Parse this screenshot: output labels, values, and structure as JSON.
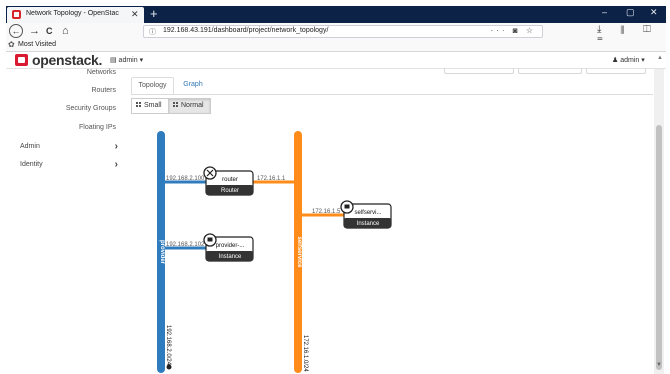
{
  "browser": {
    "tab_title": "Network Topology - OpenStac",
    "tab_close": "✕",
    "new_tab": "+",
    "window_controls": [
      "–",
      "▢",
      "✕"
    ],
    "back": "←",
    "forward": "→",
    "reload": "C",
    "home": "⌂",
    "url": "192.168.43.191/dashboard/project/network_topology/",
    "url_info_icon": "ⓘ",
    "url_actions": "··· ◙ ☆",
    "toolbar_icons": "⤓ ⫴ ◫ ≡",
    "bookmark_icon": "✿",
    "bookmark_label": "Most Visited"
  },
  "header": {
    "logo_text": "openstack.",
    "project_menu": "▤ admin ▾",
    "user_menu": "♟ admin ▾",
    "scroll_up": "▲"
  },
  "sidebar": {
    "items": [
      "Networks",
      "Routers",
      "Security Groups",
      "Floating IPs"
    ],
    "groups": [
      {
        "label": "Admin",
        "chevron": "›"
      },
      {
        "label": "Identity",
        "chevron": "›"
      }
    ]
  },
  "content": {
    "tabs": [
      "Topology",
      "Graph"
    ],
    "active_tab": "Topology",
    "size_buttons": [
      "Small",
      "Normal"
    ],
    "active_size": "Normal"
  },
  "topology": {
    "networks": [
      {
        "name": "provider",
        "cidr": "192.168.2.0/24",
        "color": "#2e7bbd"
      },
      {
        "name": "selfservice",
        "cidr": "172.16.1.0/24",
        "color": "#ff8c1a"
      }
    ],
    "devices": [
      {
        "name": "router",
        "type": "Router"
      },
      {
        "name": "selfservi...",
        "type": "Instance"
      },
      {
        "name": "provider-...",
        "type": "Instance"
      }
    ],
    "port_labels": [
      "192.168.2.100",
      "172.16.1.1",
      "172.16.1.5",
      "192.168.2.102"
    ],
    "link_colors": {
      "provider": "#2e7bbd",
      "selfservice": "#ff8c1a"
    }
  },
  "scrollbar": {
    "down_arrow": "▼"
  }
}
